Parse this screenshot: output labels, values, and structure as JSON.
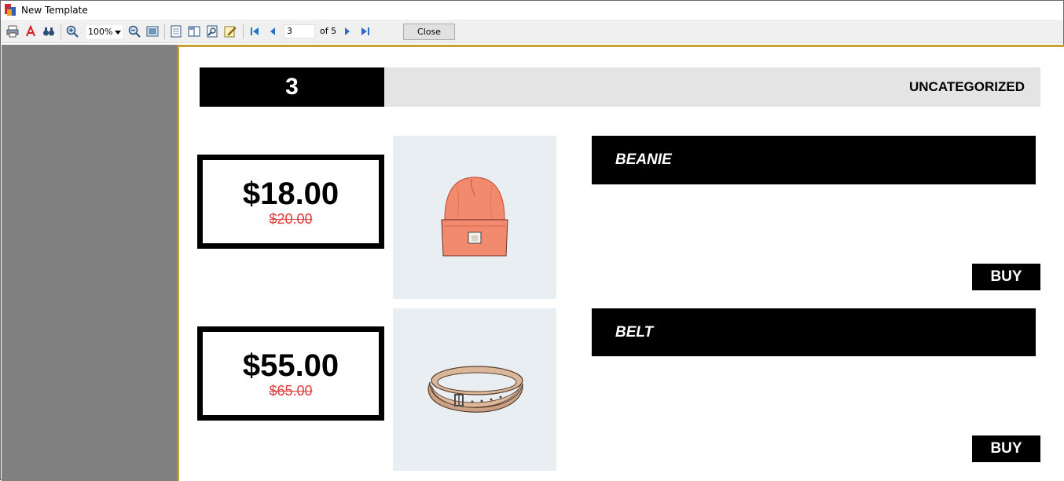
{
  "window": {
    "title": "New Template"
  },
  "toolbar": {
    "zoom_value": "100%",
    "page_current": "3",
    "page_of": "of 5",
    "close_label": "Close",
    "icons": [
      "print-icon",
      "pdf-icon",
      "find-icon",
      "zoom-in-icon",
      "zoom-out-icon",
      "fit-page-icon",
      "single-page-icon",
      "two-page-icon",
      "search-icon",
      "edit-icon",
      "first-page-icon",
      "prev-page-icon",
      "next-page-icon",
      "last-page-icon"
    ]
  },
  "page": {
    "category_number": "3",
    "category_name": "UNCATEGORIZED",
    "products": [
      {
        "name": "BEANIE",
        "price": "$18.00",
        "old_price": "$20.00",
        "buy_label": "BUY",
        "image": "beanie-icon"
      },
      {
        "name": "BELT",
        "price": "$55.00",
        "old_price": "$65.00",
        "buy_label": "BUY",
        "image": "belt-icon"
      }
    ]
  },
  "colors": {
    "accent_border": "#c9a23a",
    "old_price": "#e03a3a",
    "image_bg": "#e9eef3",
    "category_bar": "#e4e4e4"
  }
}
